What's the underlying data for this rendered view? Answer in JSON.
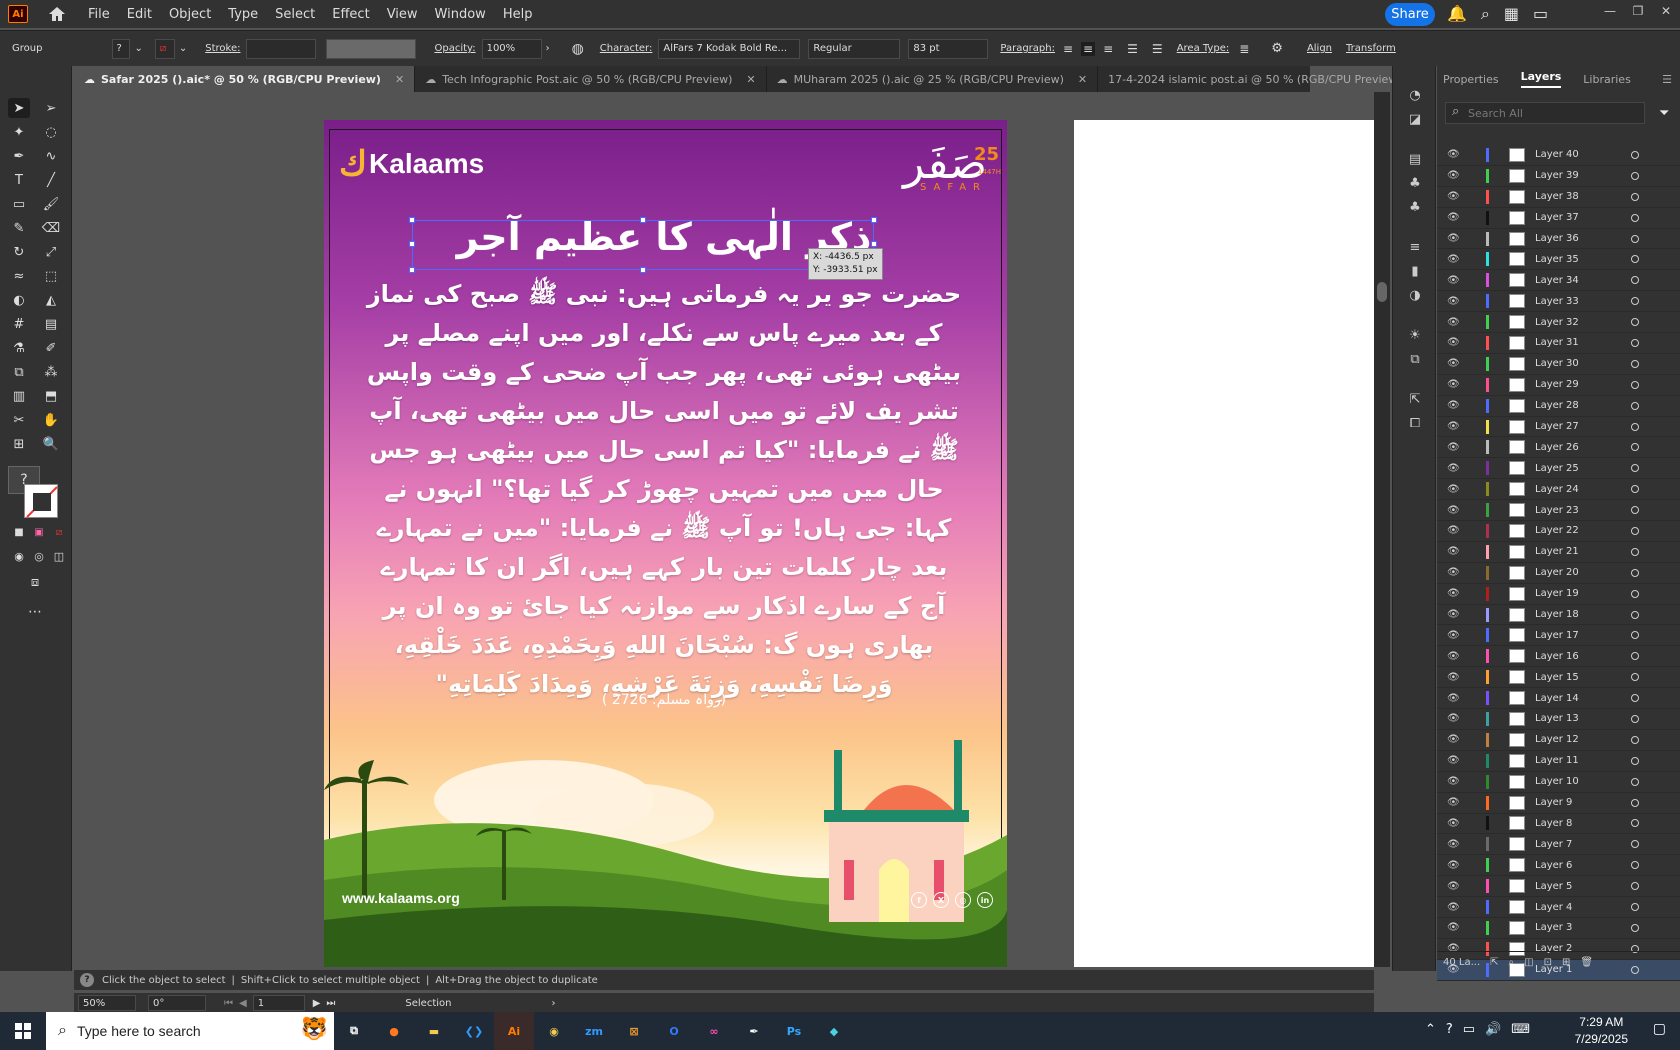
{
  "app": {
    "logo": "Ai",
    "menus": [
      "File",
      "Edit",
      "Object",
      "Type",
      "Select",
      "Effect",
      "View",
      "Window",
      "Help"
    ],
    "share": "Share"
  },
  "control": {
    "group": "Group",
    "stroke": "Stroke:",
    "opacity_label": "Opacity:",
    "opacity": "100%",
    "character": "Character:",
    "font": "AlFars 7 Kodak Bold Re...",
    "style": "Regular",
    "size": "83 pt",
    "paragraph": "Paragraph:",
    "area_type": "Area Type:",
    "align": "Align",
    "transform": "Transform",
    "question": "?"
  },
  "tabs": [
    {
      "label": "Safar 2025 ().aic* @ 50 % (RGB/CPU Preview)"
    },
    {
      "label": "Tech Infographic Post.aic @ 50 % (RGB/CPU Preview)"
    },
    {
      "label": "MUharam 2025 ().aic @ 25 % (RGB/CPU Preview)"
    },
    {
      "label": "17-4-2024 islamic post.ai @ 50 % (RGB/CPU Preview)"
    }
  ],
  "artwork": {
    "brand": "Kalaams",
    "safar_urdu": "صَفَر",
    "safar_num": "25",
    "safar_en": "SAFAR",
    "safar_year": "1447H",
    "headline": "ذکرِ الٰہی کا عظیم آجر",
    "body": "حضرت جو یر یہ فرماتی ہیں: نبی ﷺ صبح کی نماز کے بعد میرے پاس سے نکلے، اور میں اپنے مصلے پر بیٹھی ہوئی تھی، پھر جب آپ ضحی کے وقت واپس تشر یف لائے تو میں اسی حال میں بیٹھی تھی، آپ ﷺ نے فرمایا: \"کیا تم اسی حال میں بیٹھی ہو جس حال میں میں تمہیں چھوڑ کر گیا تھا؟\" انہوں نے کہا: جی ہاں! تو آپ ﷺ نے فرمایا: \"میں نے تمہارے بعد چار کلمات تین بار کہے ہیں، اگر ان کا تمہارے آج کے سارے اذکار سے موازنہ کیا جائ تو وہ ان پر بھاری ہوں گ: سُبْحَانَ اللهِ وَبِحَمْدِهِ، عَدَدَ خَلْقِهِ، وَرِضَا نَفْسِهِ، وَزِنَةَ عَرْشِهِ، وَمِدَادَ كَلِمَاتِهِ\"",
    "reference": "(رواہ مسلم: 2726 )",
    "url": "www.kalaams.org",
    "coord_x": "X: -4436.5 px",
    "coord_y": "Y: -3933.51 px"
  },
  "panel": {
    "tabs": [
      "Properties",
      "Layers",
      "Libraries"
    ],
    "search_placeholder": "Search All",
    "footer": "40 La..."
  },
  "layers": [
    {
      "name": "Layer 40",
      "color": "#4f6cff"
    },
    {
      "name": "Layer 39",
      "color": "#3fd04f"
    },
    {
      "name": "Layer 38",
      "color": "#ff4f4f"
    },
    {
      "name": "Layer 37",
      "color": "#111111"
    },
    {
      "name": "Layer 36",
      "color": "#bbbbbb"
    },
    {
      "name": "Layer 35",
      "color": "#2ee0e0"
    },
    {
      "name": "Layer 34",
      "color": "#d94fe0"
    },
    {
      "name": "Layer 33",
      "color": "#4f6cff"
    },
    {
      "name": "Layer 32",
      "color": "#3fd04f"
    },
    {
      "name": "Layer 31",
      "color": "#ff4f4f"
    },
    {
      "name": "Layer 30",
      "color": "#3fd04f"
    },
    {
      "name": "Layer 29",
      "color": "#ff4f8f"
    },
    {
      "name": "Layer 28",
      "color": "#4f6cff"
    },
    {
      "name": "Layer 27",
      "color": "#f2e04f"
    },
    {
      "name": "Layer 26",
      "color": "#bbbbbb"
    },
    {
      "name": "Layer 25",
      "color": "#7a2f9a"
    },
    {
      "name": "Layer 24",
      "color": "#8a8a1e"
    },
    {
      "name": "Layer 23",
      "color": "#3fa03f"
    },
    {
      "name": "Layer 22",
      "color": "#b02f4f"
    },
    {
      "name": "Layer 21",
      "color": "#ff9fb0"
    },
    {
      "name": "Layer 20",
      "color": "#8a6a2f"
    },
    {
      "name": "Layer 19",
      "color": "#b01e1e"
    },
    {
      "name": "Layer 18",
      "color": "#9a9aff"
    },
    {
      "name": "Layer 17",
      "color": "#4f6cff"
    },
    {
      "name": "Layer 16",
      "color": "#ff4fb0"
    },
    {
      "name": "Layer 15",
      "color": "#ff9f2f"
    },
    {
      "name": "Layer 14",
      "color": "#7a4fff"
    },
    {
      "name": "Layer 13",
      "color": "#3fa0a0"
    },
    {
      "name": "Layer 12",
      "color": "#c0803f"
    },
    {
      "name": "Layer 11",
      "color": "#1e8a6a"
    },
    {
      "name": "Layer 10",
      "color": "#2f8a2f"
    },
    {
      "name": "Layer 9",
      "color": "#ff6a1e"
    },
    {
      "name": "Layer 8",
      "color": "#111111"
    },
    {
      "name": "Layer 7",
      "color": "#6a6a6a"
    },
    {
      "name": "Layer 6",
      "color": "#3fd04f"
    },
    {
      "name": "Layer 5",
      "color": "#ff4fb0"
    },
    {
      "name": "Layer 4",
      "color": "#4f6cff"
    },
    {
      "name": "Layer 3",
      "color": "#3fd04f"
    },
    {
      "name": "Layer 2",
      "color": "#ff4f4f"
    },
    {
      "name": "Layer 1",
      "color": "#4f6cff"
    }
  ],
  "status": {
    "hint1": "Click the object to select",
    "hint2": "Shift+Click to select multiple object",
    "hint3": "Alt+Drag the object to duplicate",
    "zoom": "50%",
    "rotation": "0°",
    "artboard": "1",
    "tool": "Selection"
  },
  "taskbar": {
    "search": "Type here to search",
    "time": "7:29 AM",
    "date": "7/29/2025"
  }
}
